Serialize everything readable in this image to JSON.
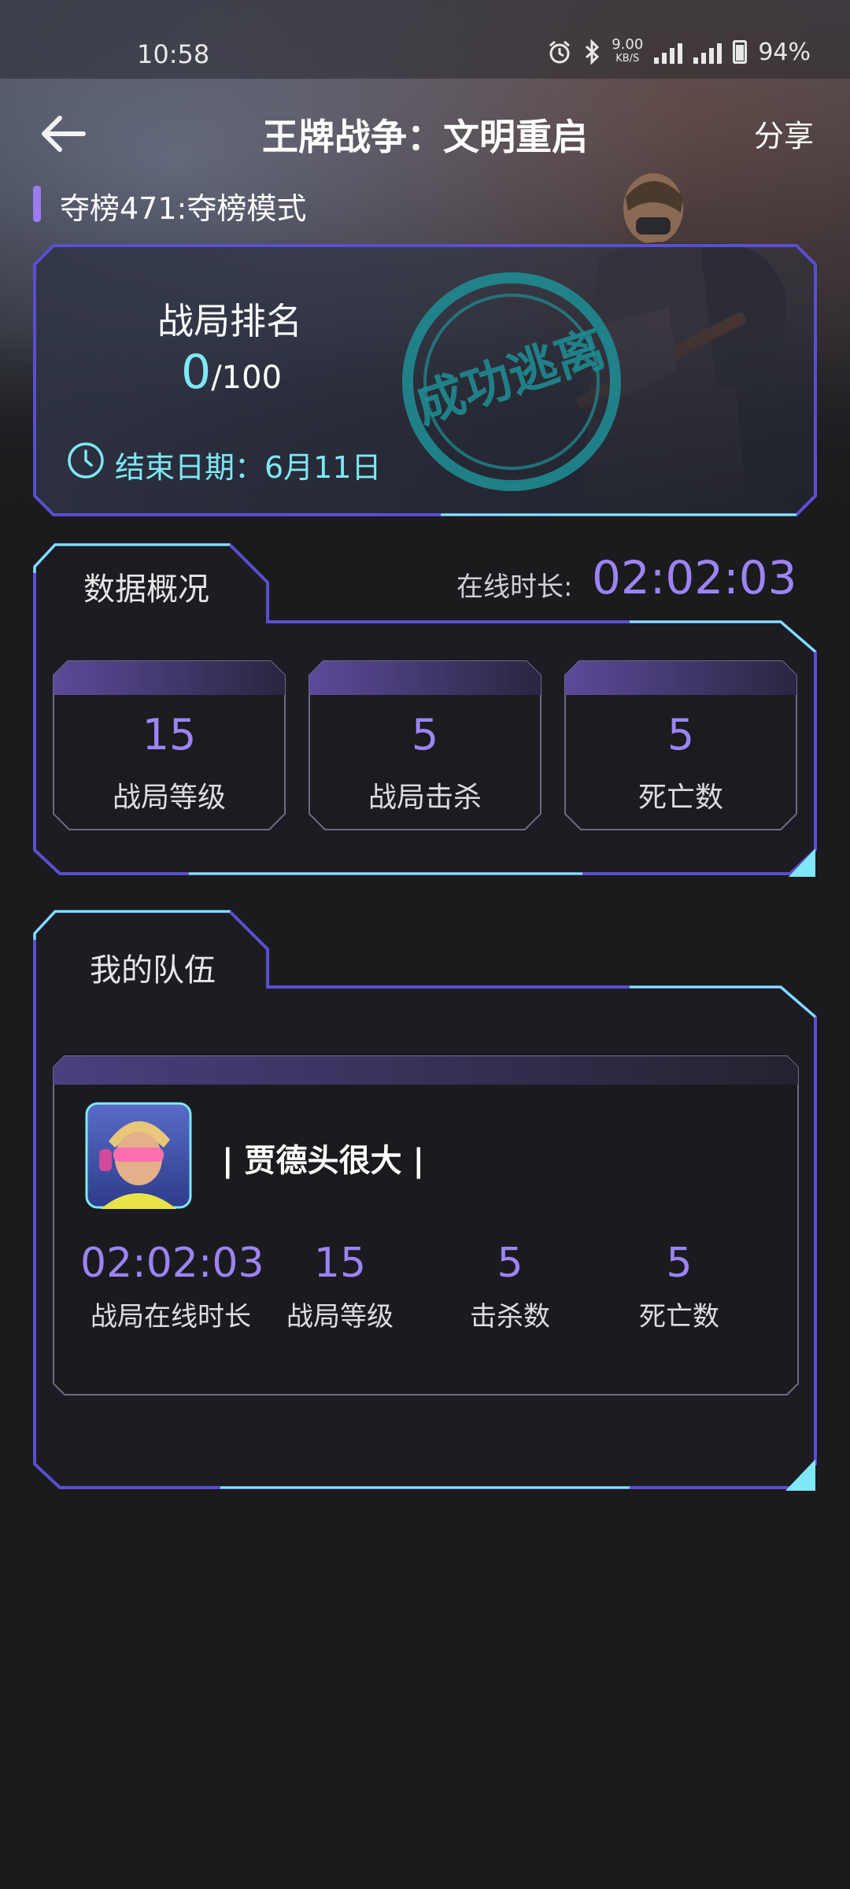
{
  "status_bar": {
    "time": "10:58",
    "net_speed": "9.00",
    "net_unit": "KB/S",
    "battery": "94%",
    "icons": [
      "alarm-icon",
      "bluetooth-icon",
      "signal-4g-icon",
      "signal-5g-icon",
      "battery-icon"
    ]
  },
  "header": {
    "title": "王牌战争：文明重启",
    "share": "分享",
    "back_icon": "back-arrow-icon"
  },
  "mode": {
    "label": "夺榜471:夺榜模式"
  },
  "rank_card": {
    "title": "战局排名",
    "rank": "0",
    "total": "/100",
    "end_date": "结束日期：6月11日",
    "stamp_text": "成功逃离"
  },
  "overview": {
    "title": "数据概况",
    "online_label": "在线时长:",
    "online_value": "02:02:03",
    "stats": [
      {
        "value": "15",
        "label": "战局等级"
      },
      {
        "value": "5",
        "label": "战局击杀"
      },
      {
        "value": "5",
        "label": "死亡数"
      }
    ]
  },
  "team": {
    "title": "我的队伍",
    "member": {
      "name": "| 贾德头很大 |",
      "stats": [
        {
          "value": "02:02:03",
          "label": "战局在线时长"
        },
        {
          "value": "15",
          "label": "战局等级"
        },
        {
          "value": "5",
          "label": "击杀数"
        },
        {
          "value": "5",
          "label": "死亡数"
        }
      ]
    }
  },
  "colors": {
    "accent_purple": "#9c84f4",
    "accent_cyan": "#7fe7f5",
    "frame_blue": "#5a4fd0",
    "background": "#1b1b1d"
  }
}
